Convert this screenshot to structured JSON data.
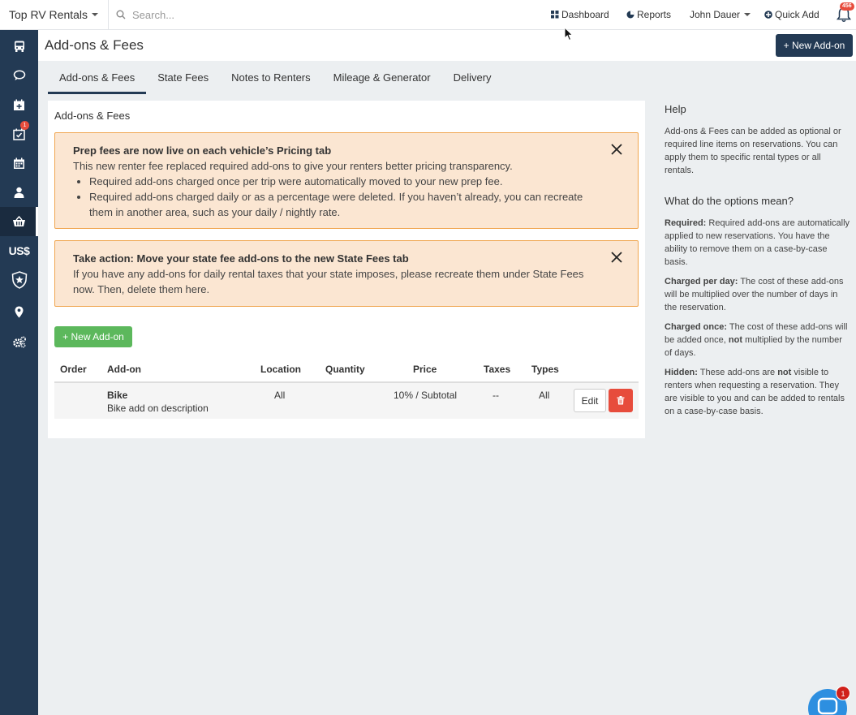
{
  "topbar": {
    "brand": "Top RV Rentals",
    "search_placeholder": "Search...",
    "dashboard": "Dashboard",
    "reports": "Reports",
    "user": "John Dauer",
    "quick_add": "Quick Add",
    "notifications_count": "456"
  },
  "sidebar": {
    "items": [
      {
        "icon": "bus-icon"
      },
      {
        "icon": "chat-icon"
      },
      {
        "icon": "calendar-plus-icon"
      },
      {
        "icon": "calendar-check-icon",
        "badge": "1"
      },
      {
        "icon": "calendar-icon"
      },
      {
        "icon": "user-icon"
      },
      {
        "icon": "basket-icon",
        "active": true
      },
      {
        "icon": "currency-icon",
        "label": "US$"
      },
      {
        "icon": "shield-icon"
      },
      {
        "icon": "location-icon"
      },
      {
        "icon": "settings-icon"
      }
    ]
  },
  "page": {
    "title": "Add-ons & Fees",
    "new_addon_label": "+ New Add-on"
  },
  "tabs": [
    "Add-ons & Fees",
    "State Fees",
    "Notes to Renters",
    "Mileage & Generator",
    "Delivery"
  ],
  "card": {
    "title": "Add-ons & Fees",
    "alert1": {
      "heading": "Prep fees are now live on each vehicle’s Pricing tab",
      "text": "This new renter fee replaced required add-ons to give your renters better pricing transparency.",
      "bullets": [
        "Required add-ons charged once per trip were automatically moved to your new prep fee.",
        "Required add-ons charged daily or as a percentage were deleted. If you haven’t already, you can recreate them in another area, such as your daily / nightly rate."
      ]
    },
    "alert2": {
      "heading": "Take action: Move your state fee add-ons to the new State Fees tab",
      "text": "If you have any add-ons for daily rental taxes that your state imposes, please recreate them under State Fees now. Then, delete them here."
    },
    "new_addon_label": "+ New Add-on",
    "table": {
      "headers": [
        "Order",
        "Add-on",
        "Location",
        "Quantity",
        "Price",
        "Taxes",
        "Types"
      ],
      "rows": [
        {
          "name": "Bike",
          "description": "Bike add on description",
          "location": "All",
          "quantity": "",
          "price": "10% / Subtotal",
          "taxes": "--",
          "types": "All",
          "edit_label": "Edit"
        }
      ]
    }
  },
  "help": {
    "title": "Help",
    "intro": "Add-ons & Fees can be added as optional or required line items on reservations. You can apply them to specific rental types or all rentals.",
    "options_title": "What do the options mean?",
    "required_label": "Required:",
    "required_text": " Required add-ons are automatically applied to new reservations. You have the ability to remove them on a case-by-case basis.",
    "per_day_label": "Charged per day:",
    "per_day_text": " The cost of these add-ons will be multiplied over the number of days in the reservation.",
    "once_label": "Charged once:",
    "once_text_a": " The cost of these add-ons will be added once, ",
    "once_not": "not",
    "once_text_b": " multiplied by the number of days.",
    "hidden_label": "Hidden:",
    "hidden_text_a": " These add-ons are ",
    "hidden_not": "not",
    "hidden_text_b": " visible to renters when requesting a reservation. They are visible to you and can be added to rentals on a case-by-case basis."
  },
  "chat": {
    "badge": "1"
  }
}
